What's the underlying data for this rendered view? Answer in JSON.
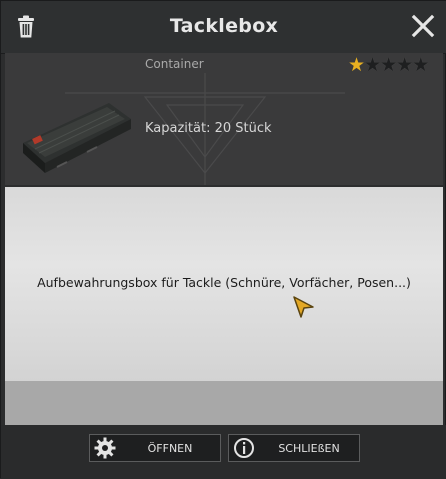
{
  "dialog": {
    "title": "Tacklebox"
  },
  "item": {
    "category": "Container",
    "capacity": "Kapazität: 20 Stück",
    "rating": 1,
    "rating_max": 5,
    "description": "Aufbewahrungsbox für Tackle (Schnüre, Vorfächer, Posen...)"
  },
  "buttons": {
    "open_label": "ÖFFNEN",
    "close_label": "SCHLIEßEN"
  },
  "icons": {
    "trash": "trash-icon",
    "close": "close-icon",
    "gear": "gear-icon",
    "info": "info-icon",
    "cursor": "mouse-cursor"
  },
  "colors": {
    "star_active": "#e8b021",
    "cursor": "#e3a826"
  }
}
